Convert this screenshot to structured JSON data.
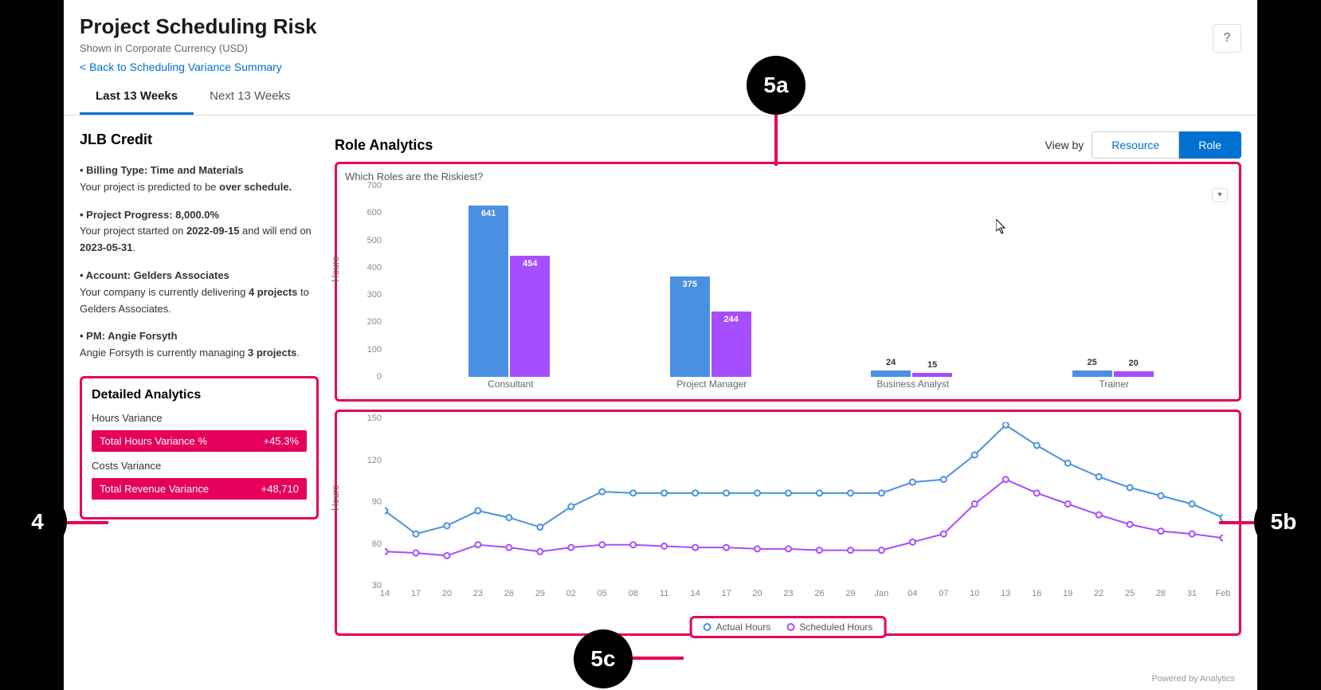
{
  "header": {
    "title": "Project Scheduling Risk",
    "subtitle": "Shown in Corporate Currency (USD)",
    "back_link": "< Back to Scheduling Variance Summary",
    "help": "?"
  },
  "tabs": {
    "last": "Last 13 Weeks",
    "next": "Next 13 Weeks"
  },
  "project": {
    "name": "JLB Credit",
    "billing_type_label": "• Billing Type: Time and Materials",
    "billing_detail_prefix": "Your project is predicted to be ",
    "billing_detail_bold": "over schedule.",
    "progress_label": "• Project Progress: 8,000.0%",
    "progress_detail_1": "Your project started on ",
    "progress_date_1": "2022-09-15",
    "progress_detail_2": " and will end on ",
    "progress_date_2": "2023-05-31",
    "progress_detail_3": ".",
    "account_label": "• Account: Gelders Associates",
    "account_detail_1": "Your company is currently delivering ",
    "account_count": "4 projects",
    "account_detail_2": " to Gelders Associates.",
    "pm_label": "• PM: Angie Forsyth",
    "pm_detail_1": "Angie Forsyth is currently managing ",
    "pm_count": "3 projects",
    "pm_detail_2": "."
  },
  "detailed": {
    "title": "Detailed Analytics",
    "hours_variance": "Hours Variance",
    "hours_bar_label": "Total Hours Variance %",
    "hours_bar_value": "+45.3%",
    "costs_variance": "Costs Variance",
    "revenue_bar_label": "Total Revenue Variance",
    "revenue_bar_value": "+48,710"
  },
  "analytics": {
    "title": "Role Analytics",
    "view_by": "View by",
    "resource": "Resource",
    "role": "Role",
    "chart_question": "Which Roles are the Riskiest?",
    "y_label": "Hours",
    "line_y_label": "Hours"
  },
  "legend": {
    "actual": "Actual Hours",
    "scheduled": "Scheduled Hours"
  },
  "footer": "Powered by Analytics",
  "callouts": {
    "four": "4",
    "five_a": "5a",
    "five_b": "5b",
    "five_c": "5c"
  },
  "chart_data": [
    {
      "type": "bar",
      "title": "Which Roles are the Riskiest?",
      "ylabel": "Hours",
      "ylim": [
        0,
        700
      ],
      "categories": [
        "Consultant",
        "Project Manager",
        "Business Analyst",
        "Trainer"
      ],
      "series": [
        {
          "name": "Actual",
          "color": "#4a90e2",
          "values": [
            641,
            375,
            24,
            25
          ]
        },
        {
          "name": "Scheduled",
          "color": "#a64dff",
          "values": [
            454,
            244,
            15,
            20
          ]
        }
      ]
    },
    {
      "type": "line",
      "ylabel": "Hours",
      "ylim": [
        30,
        150
      ],
      "x": [
        "14",
        "17",
        "20",
        "23",
        "26",
        "29",
        "02",
        "05",
        "08",
        "11",
        "14",
        "17",
        "20",
        "23",
        "26",
        "29",
        "Jan",
        "04",
        "07",
        "10",
        "13",
        "16",
        "19",
        "22",
        "25",
        "28",
        "31",
        "Feb"
      ],
      "series": [
        {
          "name": "Actual Hours",
          "color": "#4a90e2",
          "values": [
            85,
            68,
            74,
            85,
            80,
            73,
            88,
            99,
            98,
            98,
            98,
            98,
            98,
            98,
            98,
            98,
            98,
            106,
            108,
            126,
            148,
            133,
            120,
            110,
            102,
            96,
            90,
            80
          ]
        },
        {
          "name": "Scheduled Hours",
          "color": "#a64dff",
          "values": [
            55,
            54,
            52,
            60,
            58,
            55,
            58,
            60,
            60,
            59,
            58,
            58,
            57,
            57,
            56,
            56,
            56,
            62,
            68,
            90,
            108,
            98,
            90,
            82,
            75,
            70,
            68,
            65
          ]
        }
      ]
    }
  ]
}
